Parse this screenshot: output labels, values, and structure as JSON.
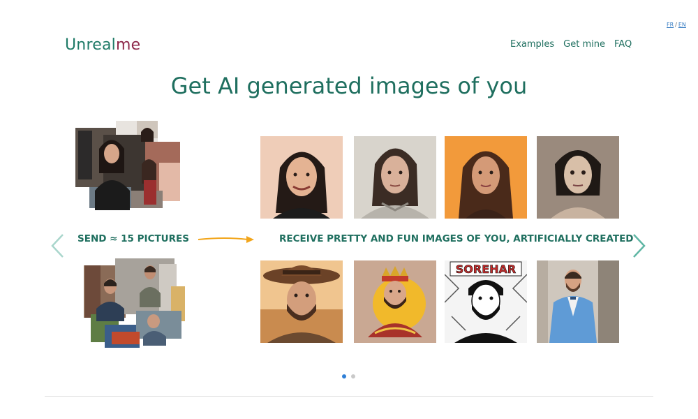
{
  "lang": {
    "fr": "FR",
    "sep": "/",
    "en": "EN"
  },
  "logo": {
    "part1": "Unreal",
    "part2": "me"
  },
  "nav": {
    "examples": "Examples",
    "get_mine": "Get mine",
    "faq": "FAQ"
  },
  "headline": "Get AI generated images of you",
  "carousel": {
    "send_label": "SEND ≈ 15 PICTURES",
    "receive_label": "RECEIVE PRETTY AND FUN IMAGES OF YOU, ARTIFICIALLY CREATED",
    "slides_total": 2,
    "active_slide": 1
  },
  "images": {
    "female_results": [
      "portrait-woman-smiling",
      "portrait-woman-armor",
      "portrait-woman-orange",
      "portrait-woman-gothic"
    ],
    "male_results": [
      "portrait-man-cowboy",
      "portrait-man-king",
      "portrait-man-coloring-book",
      "portrait-man-blue-suit"
    ],
    "coloring_book_text": "SOREHAR"
  },
  "colors": {
    "brand_green": "#1f6f5f",
    "brand_maroon": "#8e2a4b",
    "accent_orange": "#f2a51a",
    "dot_active": "#2f7fd6"
  }
}
